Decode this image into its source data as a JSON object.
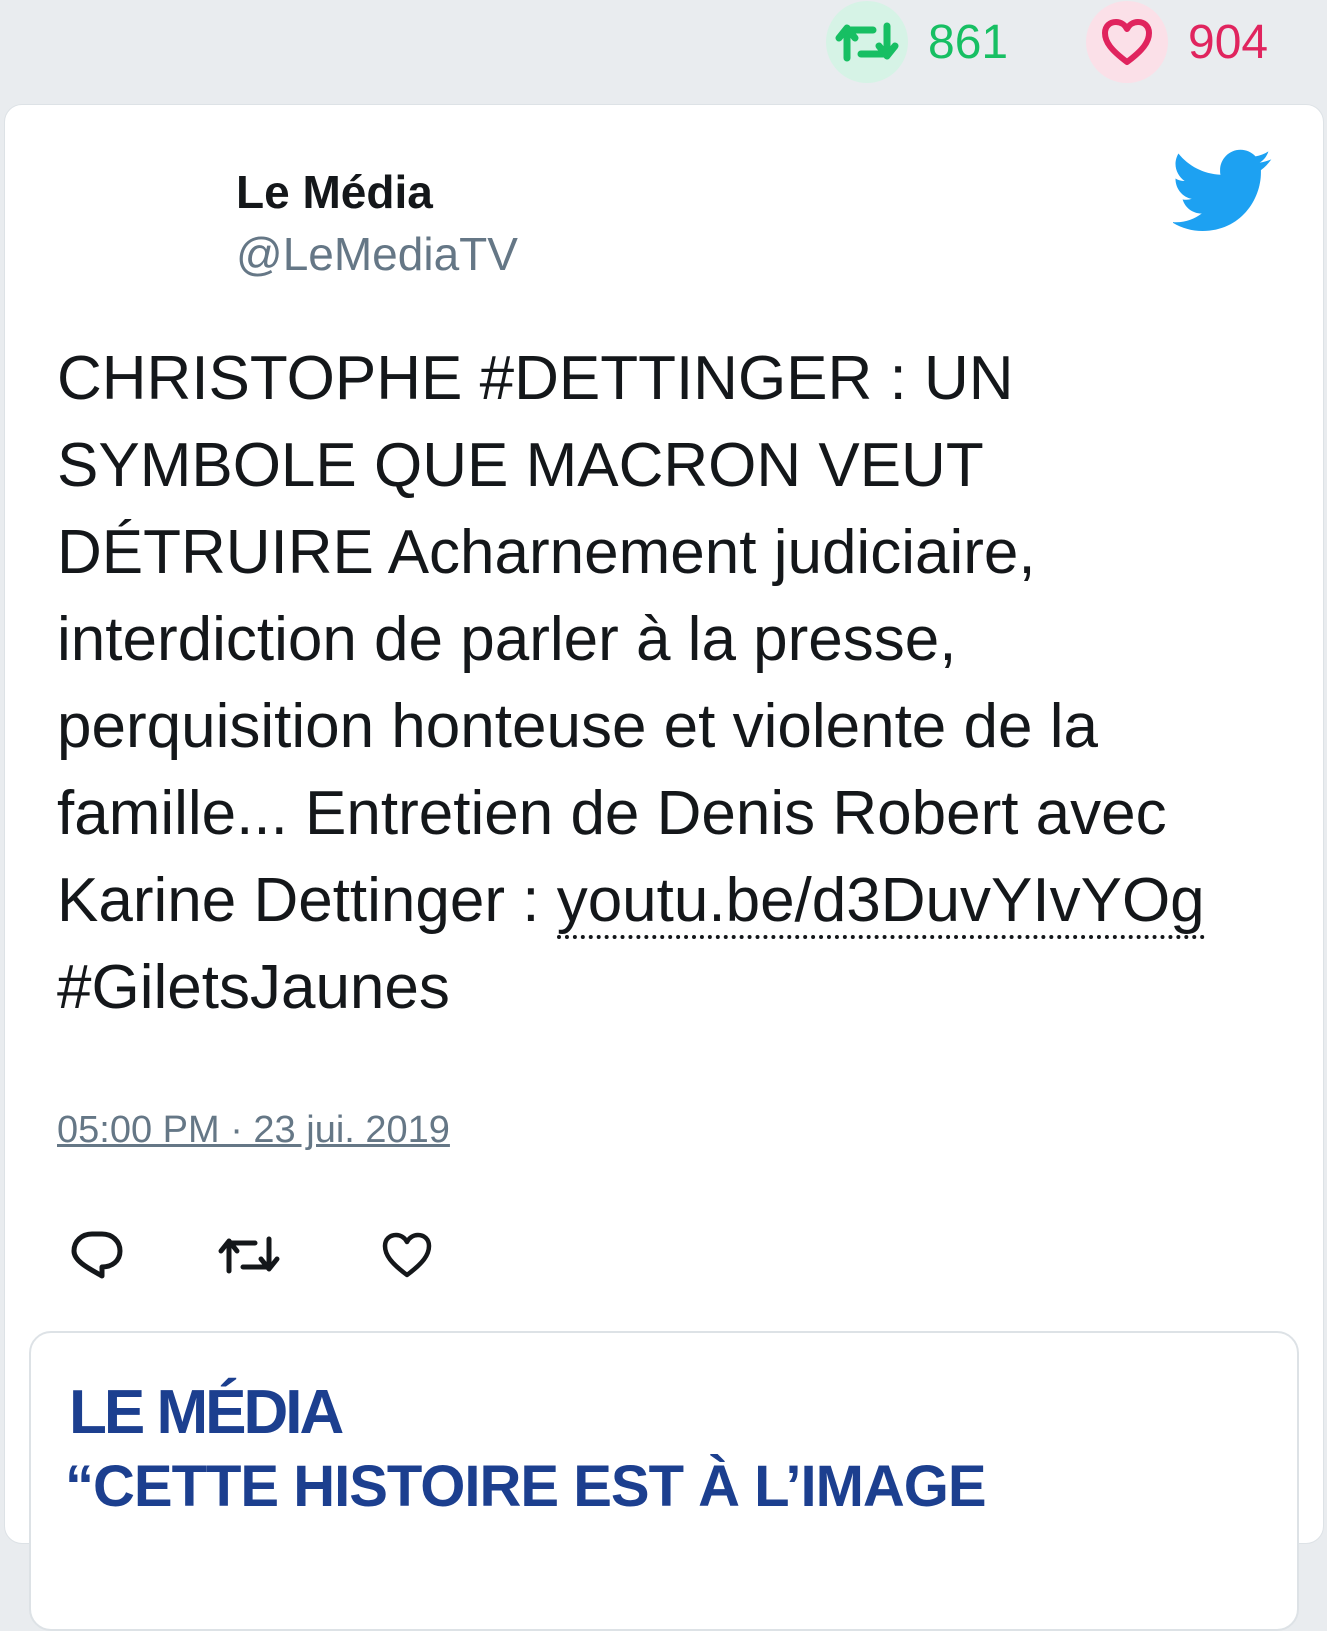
{
  "stats": {
    "retweets": "861",
    "likes": "904",
    "retweet_color": "#17bf63",
    "like_color": "#e0245e"
  },
  "tweet": {
    "author_name": "Le Média",
    "author_handle": "@LeMediaTV",
    "text_main": "CHRISTOPHE #DETTINGER : UN SYMBOLE QUE MACRON VEUT DÉTRUIRE Acharnement judiciaire, interdiction de parler à la presse, perquisition honteuse et violente de la famille... Entretien de Denis Robert avec Karine Dettinger : ",
    "link": "youtu.be/d3DuvYIvYOg",
    "hashtag": "#GiletsJaunes",
    "timestamp": "05:00 PM · 23 jui. 2019"
  },
  "actions": {
    "reply_icon": "reply-icon",
    "retweet_icon": "retweet-icon",
    "like_icon": "heart-icon"
  },
  "preview": {
    "logo_text": "LE MÉDIA",
    "headline": "“CETTE HISTOIRE EST À L’IMAGE"
  },
  "brand": {
    "twitter_blue": "#1da1f2"
  }
}
